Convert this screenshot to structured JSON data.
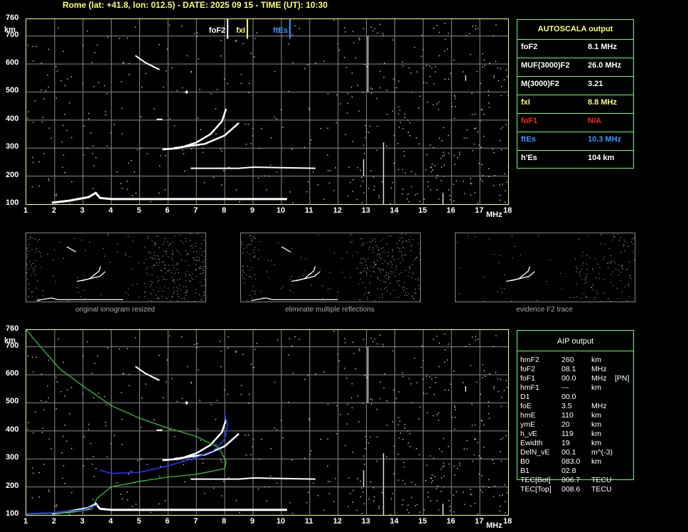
{
  "header": {
    "station": "Rome (lat: +41.8, lon: 012.5) - DATE: 2025 09 15 - TIME (UT): 10:30"
  },
  "axes": {
    "y_unit": "km",
    "x_unit": "MHz",
    "y_ticks": [
      "760",
      "700",
      "600",
      "500",
      "400",
      "300",
      "200",
      "100"
    ],
    "x_ticks": [
      "1",
      "2",
      "3",
      "4",
      "5",
      "6",
      "7",
      "8",
      "9",
      "10",
      "11",
      "12",
      "13",
      "14",
      "15",
      "16",
      "17",
      "18"
    ]
  },
  "markers": {
    "foF2": "foF2",
    "fxI": "fxI",
    "ftEs": "ftEs"
  },
  "autoscala": {
    "title": "AUTOSCALA output",
    "rows": [
      {
        "label": "foF2",
        "value": "8.1 MHz",
        "color": "#ffffff"
      },
      {
        "label": "MUF(3000)F2",
        "value": "26.0 MHz",
        "color": "#ffffff"
      },
      {
        "label": "M(3000)F2",
        "value": "3.21",
        "color": "#ffffff"
      },
      {
        "label": "fxI",
        "value": "8.8 MHz",
        "color": "#ffff66"
      },
      {
        "label": "foF1",
        "value": "N/A",
        "color": "#ff2020"
      },
      {
        "label": "ftEs",
        "value": "10.3 MHz",
        "color": "#3399ff"
      },
      {
        "label": "h'Es",
        "value": "104    km",
        "color": "#ffffff"
      }
    ]
  },
  "thumbnails": [
    {
      "label": "original ionogram resized"
    },
    {
      "label": "eliminate multiple reflections"
    },
    {
      "label": "evidence F2 trace"
    }
  ],
  "aip": {
    "title": "AIP output",
    "rows": [
      {
        "name": "hmF2",
        "value": "260",
        "unit": "km",
        "extra": ""
      },
      {
        "name": "foF2",
        "value": "08.1",
        "unit": "MHz",
        "extra": ""
      },
      {
        "name": "foF1",
        "value": "00.0",
        "unit": "MHz",
        "extra": "[PN]"
      },
      {
        "name": "hmF1",
        "value": "---",
        "unit": "km",
        "extra": ""
      },
      {
        "name": "D1",
        "value": "00.0",
        "unit": "",
        "extra": ""
      },
      {
        "name": "foE",
        "value": "3.5",
        "unit": "MHz",
        "extra": ""
      },
      {
        "name": "hmE",
        "value": "110",
        "unit": "km",
        "extra": ""
      },
      {
        "name": "ymE",
        "value": "20",
        "unit": "km",
        "extra": ""
      },
      {
        "name": "h_vE",
        "value": "119",
        "unit": "km",
        "extra": ""
      },
      {
        "name": "Ewidth",
        "value": "19",
        "unit": "km",
        "extra": ""
      },
      {
        "name": "DelN_vE",
        "value": "00.1",
        "unit": "m^(-3)",
        "extra": ""
      },
      {
        "name": "B0",
        "value": "083.0",
        "unit": "km",
        "extra": ""
      },
      {
        "name": "B1",
        "value": "02.8",
        "unit": "",
        "extra": ""
      },
      {
        "name": "TEC[Bot]",
        "value": "006.7",
        "unit": "TECU",
        "extra": ""
      },
      {
        "name": "TEC[Top]",
        "value": "008.6",
        "unit": "TECU",
        "extra": ""
      }
    ]
  },
  "colors": {
    "frame": "#ffff66",
    "grid": "#8a8a8a",
    "panel_border": "#66ff66",
    "profile": "#33cc33",
    "blue_trace": "#2233ff"
  }
}
